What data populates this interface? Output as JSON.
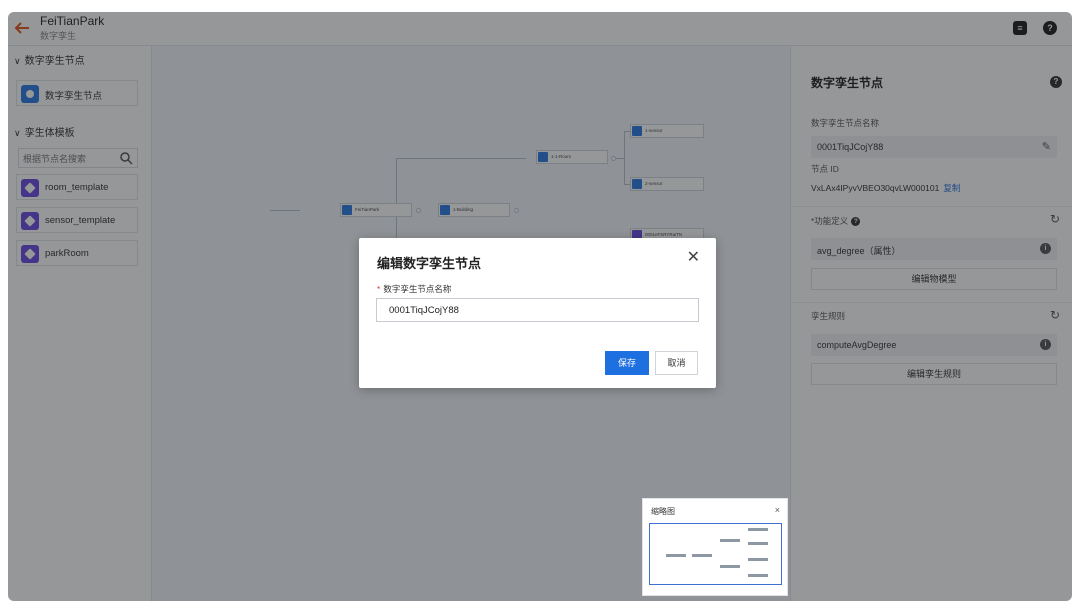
{
  "header": {
    "back_icon": "arrow-left-icon",
    "title": "FeiTianPark",
    "subtitle": "数字孪生",
    "doc_icon": "document-icon",
    "help_icon": "help-icon"
  },
  "sidebar": {
    "section1_title": "数字孪生节点",
    "twin_node_label": "数字孪生节点",
    "section2_title": "孪生体模板",
    "search_placeholder": "根据节点名搜索",
    "templates": [
      {
        "label": "room_template"
      },
      {
        "label": "sensor_template"
      },
      {
        "label": "parkRoom"
      }
    ]
  },
  "canvas": {
    "nodes": [
      {
        "label": "FeiTianPark"
      },
      {
        "label": "1-Building"
      },
      {
        "label": "1-1-Room"
      },
      {
        "label": "1-sensor"
      },
      {
        "label": "2-sensor"
      },
      {
        "label": "0001eFSRYRaiTN"
      }
    ],
    "minimap_title": "缩略图",
    "minimap_close": "×"
  },
  "right_panel": {
    "title": "数字孪生节点",
    "name_label": "数字孪生节点名称",
    "name_value": "0001TiqJCojY88",
    "id_label": "节点 ID",
    "id_value": "VxLAx4IPyvVBEO30qvLW000101",
    "copy_label": "复制",
    "func_label": "*功能定义",
    "func_value": "avg_degree（属性）",
    "edit_model_button": "编辑物模型",
    "rules_label": "孪生规则",
    "rule_value": "computeAvgDegree",
    "edit_rules_button": "编辑孪生规则"
  },
  "modal": {
    "title": "编辑数字孪生节点",
    "field_label": "数字孪生节点名称",
    "required_mark": "*",
    "field_value": "0001TiqJCojY88",
    "save_button": "保存",
    "cancel_button": "取消",
    "close_icon": "close-icon"
  },
  "colors": {
    "accent": "#1e6fe0",
    "back_arrow": "#e8541e",
    "template_icon": "#6b4be0",
    "node_icon": "#2b7be4"
  }
}
